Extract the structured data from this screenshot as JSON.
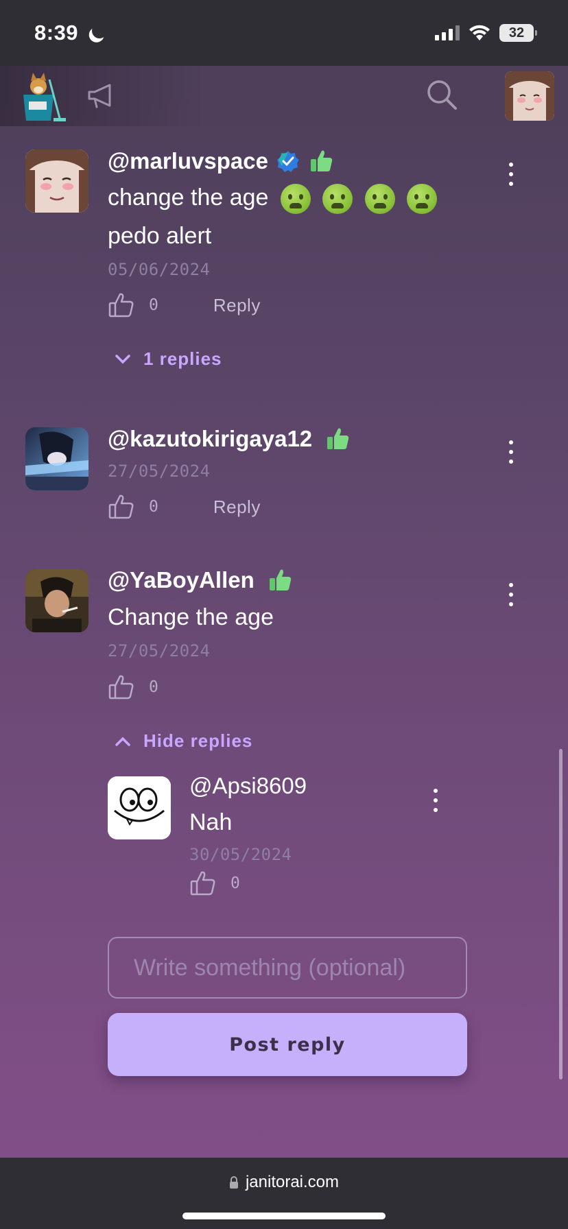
{
  "status_bar": {
    "time": "8:39",
    "battery": "32"
  },
  "header": {
    "logo": "bucket-dog-logo",
    "announce_icon": "megaphone-icon",
    "search_icon": "search-icon"
  },
  "comments": [
    {
      "username": "@marluvspace",
      "text_line1": "change the age",
      "text_line2": "pedo alert",
      "date": "05/06/2024",
      "likes": "0",
      "reply_label": "Reply",
      "replies_toggle": "1 replies"
    },
    {
      "username": "@kazutokirigaya12",
      "date": "27/05/2024",
      "likes": "0",
      "reply_label": "Reply"
    },
    {
      "username": "@YaBoyAllen",
      "text": "Change the age",
      "date": "27/05/2024",
      "likes": "0",
      "replies_toggle": "Hide replies",
      "replies": [
        {
          "username": "@Apsi8609",
          "text": "Nah",
          "date": "30/05/2024",
          "likes": "0"
        }
      ]
    }
  ],
  "reply_form": {
    "placeholder": "Write something (optional)",
    "submit_label": "Post reply"
  },
  "browser": {
    "url": "janitorai.com"
  },
  "colors": {
    "accent": "#c9a6ff",
    "button": "#c7b0fb",
    "bar": "#2f2e34"
  }
}
